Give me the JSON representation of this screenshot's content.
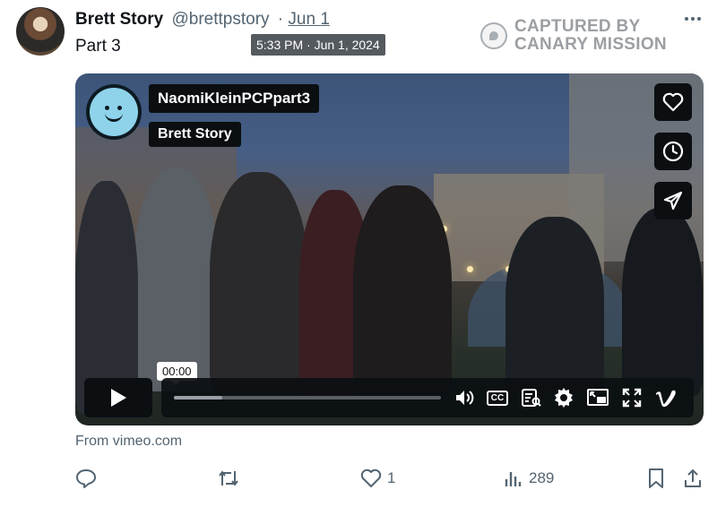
{
  "post": {
    "author_name": "Brett Story",
    "handle": "@brettpstory",
    "separator": "·",
    "date": "Jun 1",
    "text": "Part 3",
    "timestamp_tooltip": "5:33 PM · Jun 1, 2024"
  },
  "watermark": {
    "line1": "CAPTURED BY",
    "line2": "CANARY MISSION"
  },
  "video": {
    "title": "NaomiKleinPCPpart3",
    "byline": "Brett Story",
    "current_time": "00:00",
    "progress": 0.18,
    "cc_label": "CC"
  },
  "source": {
    "text": "From vimeo.com"
  },
  "actions": {
    "reply_count": "",
    "repost_count": "",
    "like_count": "1",
    "views_count": "289"
  },
  "icons": [
    "avatar",
    "more-icon",
    "canary-seal-icon",
    "smiley-logo-icon",
    "heart-icon",
    "clock-icon",
    "send-icon",
    "play-icon",
    "volume-icon",
    "cc-icon",
    "transcript-icon",
    "gear-icon",
    "pip-icon",
    "fullscreen-icon",
    "vimeo-icon",
    "reply-icon",
    "repost-icon",
    "like-icon",
    "views-icon",
    "bookmark-icon",
    "share-icon"
  ]
}
